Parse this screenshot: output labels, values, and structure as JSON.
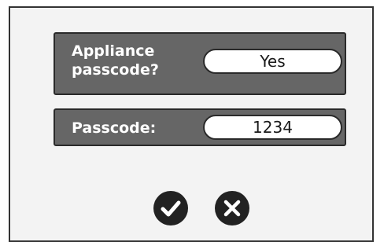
{
  "dialog": {
    "appliance_passcode": {
      "label_line1": "Appliance",
      "label_line2": "passcode?",
      "value": "Yes"
    },
    "passcode": {
      "label": "Passcode:",
      "value": "1234"
    },
    "buttons": {
      "confirm_icon": "checkmark-icon",
      "cancel_icon": "close-icon"
    }
  },
  "colors": {
    "panel_bg": "#666666",
    "screen_bg": "#f3f3f3",
    "button_bg": "#222222",
    "field_bg": "#ffffff"
  }
}
